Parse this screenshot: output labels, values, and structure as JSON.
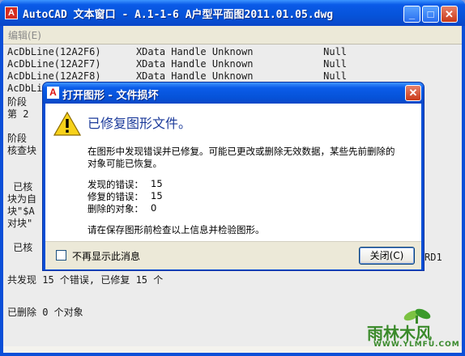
{
  "window": {
    "app_icon_glyph": "A",
    "title": "AutoCAD 文本窗口 - A.1-1-6 A户型平面图2011.01.05.dwg",
    "minimize_glyph": "_",
    "maximize_glyph": "□",
    "close_glyph": "✕"
  },
  "menubar": {
    "edit_label": "编辑(E)"
  },
  "text_window": {
    "lines": [
      "AcDbLine(12A2F6)      XData Handle Unknown            Null",
      "AcDbLine(12A2F7)      XData Handle Unknown            Null",
      "AcDbLine(12A2F8)      XData Handle Unknown            Null",
      "AcDbLine(12A2F9)      XData Handle Unknown            Null",
      "阶段",
      "第 2",
      "",
      "阶段",
      "核查块",
      "",
      "",
      " 已核",
      "块为自",
      "块\"$A",
      "对块\"",
      "",
      " 已核",
      "",
      "共发现 15 个错误, 已修复 15 个",
      "",
      "已删除 0 个对象"
    ],
    "right_fragment": "RD1"
  },
  "dialog": {
    "title_icon_glyph": "A",
    "title": "打开图形 - 文件损坏",
    "close_glyph": "✕",
    "heading": "已修复图形文件。",
    "message_line1": "在图形中发现错误并已修复。可能已更改或删除无效数据，某些先前删除的",
    "message_line2": "对象可能已恢复。",
    "stats": [
      {
        "label": "发现的错误：",
        "value": "15"
      },
      {
        "label": "修复的错误：",
        "value": "15"
      },
      {
        "label": "删除的对象：",
        "value": "0"
      }
    ],
    "advice": "请在保存图形前检查以上信息并检验图形。",
    "checkbox_label": "不再显示此消息",
    "checkbox_checked": false,
    "close_button": "关闭(C)"
  },
  "watermark": {
    "text": "雨林木风",
    "url": "WWW.YLMFU.COM"
  }
}
